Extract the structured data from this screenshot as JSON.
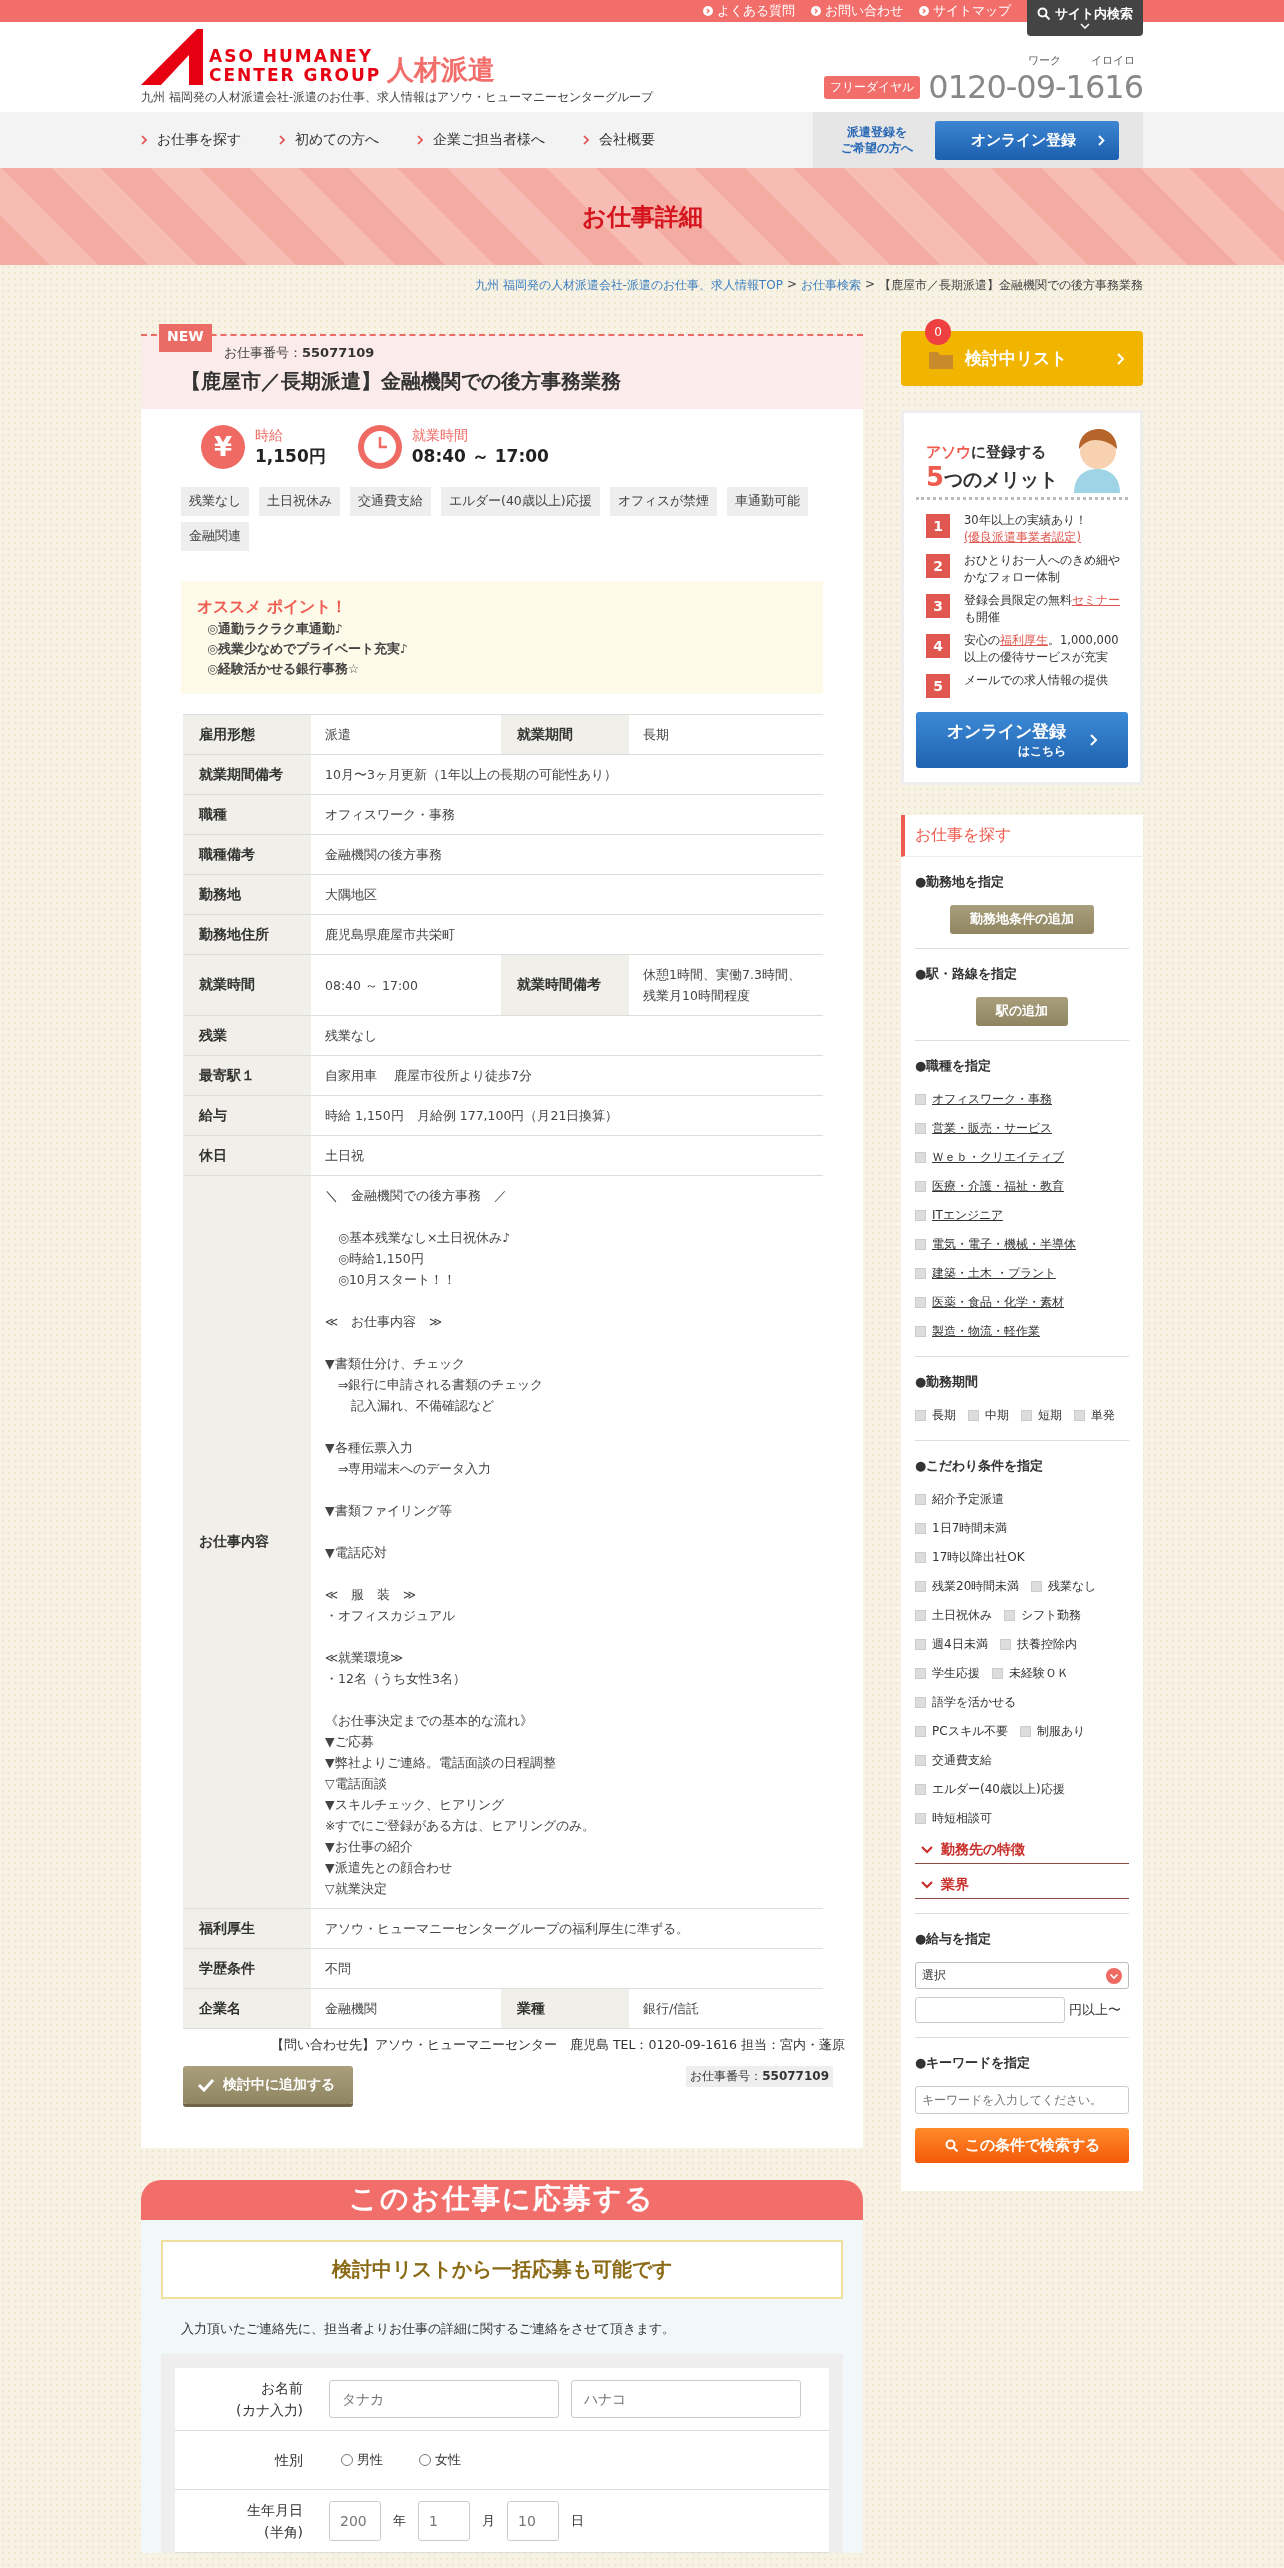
{
  "top_links": [
    "よくある質問",
    "お問い合わせ",
    "サイトマップ"
  ],
  "site_search": "サイト内検索",
  "header": {
    "logo_line1": "ASO HUMANEY",
    "logo_line2": "CENTER GROUP",
    "logo_suffix": "人材派遣",
    "tagline": "九州 福岡発の人材派遣会社-派遣のお仕事、求人情報はアソウ・ヒューマニーセンターグループ",
    "phone_badge": "フリーダイヤル",
    "phone_reading_1": "ワーク",
    "phone_reading_2": "イロイロ",
    "phone": "0120-09-1616"
  },
  "nav": {
    "items": [
      "お仕事を探す",
      "初めての方へ",
      "企業ご担当者様へ",
      "会社概要"
    ],
    "register_note": [
      "派遣登録を",
      "ご希望の方へ"
    ],
    "register_button": "オンライン登録"
  },
  "banner_title": "お仕事詳細",
  "breadcrumb": {
    "separator": ">",
    "links": [
      "九州 福岡発の人材派遣会社-派遣のお仕事、求人情報TOP",
      "お仕事検索"
    ],
    "current": "【鹿屋市／長期派遣】金融機関での後方事務業務"
  },
  "job": {
    "badge": "NEW",
    "number": "お仕事番号：**55077109**",
    "title": "【鹿屋市／長期派遣】金融機関での後方事務業務",
    "wage_symbol": "¥",
    "wage_label": "時給",
    "wage": "1,150円",
    "hours_label": "就業時間",
    "hours": "08:40 ～ 17:00",
    "tags": [
      "残業なし",
      "土日祝休み",
      "交通費支給",
      "エルダー(40歳以上)応援",
      "オフィスが禁煙",
      "車通勤可能",
      "金融関連"
    ],
    "points_title": "オススメ ポイント！",
    "points": [
      "◎通勤ラクラク車通勤♪",
      "◎残業少なめでプライベート充実♪",
      "◎経験活かせる銀行事務☆"
    ],
    "table": [
      {
        "cells": [
          {
            "label": "雇用形態",
            "value": "派遣"
          },
          {
            "label": "就業期間",
            "value": "長期"
          }
        ]
      },
      {
        "cells": [
          {
            "label": "就業期間備考",
            "value": "10月〜3ヶ月更新（1年以上の長期の可能性あり）"
          }
        ]
      },
      {
        "cells": [
          {
            "label": "職種",
            "value": "オフィスワーク・事務"
          }
        ]
      },
      {
        "cells": [
          {
            "label": "職種備考",
            "value": "金融機関の後方事務"
          }
        ]
      },
      {
        "cells": [
          {
            "label": "勤務地",
            "value": "大隅地区"
          }
        ]
      },
      {
        "cells": [
          {
            "label": "勤務地住所",
            "value": "鹿児島県鹿屋市共栄町"
          }
        ]
      },
      {
        "cells": [
          {
            "label": "就業時間",
            "value": "08:40 ～ 17:00"
          },
          {
            "label": "就業時間備考",
            "blocks": [
              [
                "休憩1時間、実働7.3時間、",
                "残業月10時間程度"
              ]
            ]
          }
        ]
      },
      {
        "cells": [
          {
            "label": "残業",
            "value": "残業なし"
          }
        ]
      },
      {
        "cells": [
          {
            "label": "最寄駅１",
            "value": "自家用車　 鹿屋市役所より徒歩7分"
          }
        ]
      },
      {
        "cells": [
          {
            "label": "給与",
            "value": "時給 1,150円　月給例 177,100円（月21日換算）"
          }
        ]
      },
      {
        "cells": [
          {
            "label": "休日",
            "value": "土日祝"
          }
        ]
      },
      {
        "cells": [
          {
            "label": "お仕事内容",
            "blocks": [
              [
                "＼　金融機関での後方事務　／"
              ],
              [
                "　◎基本残業なし×土日祝休み♪",
                "　◎時給1,150円",
                "　◎10月スタート！！"
              ],
              [
                "≪　お仕事内容　≫"
              ],
              [
                "▼書類仕分け、チェック",
                "　⇒銀行に申請される書類のチェック",
                "　　記入漏れ、不備確認など"
              ],
              [
                "▼各種伝票入力",
                "　⇒専用端末へのデータ入力"
              ],
              [
                "▼書類ファイリング等"
              ],
              [
                "▼電話応対"
              ],
              [
                "≪　服　装　≫",
                "・オフィスカジュアル"
              ],
              [
                "≪就業環境≫",
                "・12名（うち女性3名）"
              ],
              [
                "《お仕事決定までの基本的な流れ》",
                "▼ご応募",
                "▼弊社よりご連絡。電話面談の日程調整",
                "▽電話面談",
                "▼スキルチェック、ヒアリング",
                "※すでにご登録がある方は、ヒアリングのみ。",
                "▼お仕事の紹介",
                "▼派遣先との顔合わせ",
                "▽就業決定"
              ]
            ]
          }
        ]
      },
      {
        "cells": [
          {
            "label": "福利厚生",
            "value": "アソウ・ヒューマニーセンターグループの福利厚生に準ずる。"
          }
        ]
      },
      {
        "cells": [
          {
            "label": "学歴条件",
            "value": "不問"
          }
        ]
      },
      {
        "cells": [
          {
            "label": "企業名",
            "value": "金融機関"
          },
          {
            "label": "業種",
            "value": "銀行/信託"
          }
        ]
      }
    ],
    "contact": "【問い合わせ先】アソウ・ヒューマニーセンター　鹿児島 TEL：0120-09-1616 担当：宮内・蓬原",
    "add_button": "検討中に追加する",
    "number_footer": "お仕事番号：**55077109**"
  },
  "apply": {
    "title": "このお仕事に応募する",
    "bulk_note": "検討中リストから一括応募も可能です",
    "intro": "入力頂いたご連絡先に、担当者よりお仕事の詳細に関するご連絡をさせて頂きます。",
    "rows": [
      {
        "kind": "name",
        "label": "お名前\n(カナ入力)",
        "placeholders": [
          "タナカ",
          "ハナコ"
        ]
      },
      {
        "kind": "radio",
        "label": "性別",
        "options": [
          {
            "label": "男性",
            "selected": false
          },
          {
            "label": "女性",
            "selected": false
          }
        ]
      },
      {
        "kind": "date",
        "label": "生年月日\n(半角)",
        "fields": [
          {
            "placeholder": "200",
            "unit": "年"
          },
          {
            "placeholder": "1",
            "unit": "月"
          },
          {
            "placeholder": "10",
            "unit": "日"
          }
        ]
      }
    ]
  },
  "sidebar": {
    "list_button": "検討中リスト",
    "list_count": "0",
    "merit": {
      "heading": [
        [
          {
            "text": "アソウ",
            "accent": true
          },
          {
            "text": "に登録する",
            "accent": false
          }
        ],
        [
          {
            "text": "5",
            "accent": true
          },
          {
            "text": "つのメリット",
            "accent": false
          }
        ]
      ],
      "items": [
        {
          "number": "1",
          "parts": [
            {
              "text": "30年以上の実績あり！",
              "link": false
            },
            {
              "text": "(優良派遣事業者認定)",
              "link": true
            }
          ]
        },
        {
          "number": "2",
          "parts": [
            {
              "text": "おひとりお一人へのきめ細やかなフォロー体制",
              "link": false
            }
          ]
        },
        {
          "number": "3",
          "parts": [
            {
              "text": "登録会員限定の無料",
              "link": false
            },
            {
              "text": "セミナー",
              "link": true
            },
            {
              "text": "も開催",
              "link": false
            }
          ]
        },
        {
          "number": "4",
          "parts": [
            {
              "text": "安心の",
              "link": false
            },
            {
              "text": "福利厚生",
              "link": true
            },
            {
              "text": "。1,000,000以上の優待サービスが充実",
              "link": false
            }
          ]
        },
        {
          "number": "5",
          "parts": [
            {
              "text": "メールでの求人情報の提供",
              "link": false
            }
          ]
        }
      ],
      "button_main": "オンライン登録",
      "button_sub": "はこちら"
    },
    "search": {
      "title": "お仕事を探す",
      "sections": [
        {
          "kind": "button",
          "heading": "●勤務地を指定",
          "button": "勤務地条件の追加"
        },
        {
          "kind": "button",
          "heading": "●駅・路線を指定",
          "button": "駅の追加"
        },
        {
          "kind": "links",
          "heading": "●職種を指定",
          "items": [
            {
              "label": "オフィスワーク・事務",
              "checked": false
            },
            {
              "label": "営業・販売・サービス",
              "checked": false
            },
            {
              "label": "Ｗｅｂ・クリエイティブ",
              "checked": false
            },
            {
              "label": "医療・介護・福祉・教育",
              "checked": false
            },
            {
              "label": "ITエンジニア",
              "checked": false
            },
            {
              "label": "電気・電子・機械・半導体",
              "checked": false
            },
            {
              "label": "建築・土木 ・プラント",
              "checked": false
            },
            {
              "label": "医薬・食品・化学・素材",
              "checked": false
            },
            {
              "label": "製造・物流・軽作業",
              "checked": false
            }
          ]
        },
        {
          "kind": "rows",
          "heading": "●勤務期間",
          "rows": [
            [
              {
                "label": "長期",
                "checked": false
              },
              {
                "label": "中期",
                "checked": false
              },
              {
                "label": "短期",
                "checked": false
              },
              {
                "label": "単発",
                "checked": false
              }
            ]
          ]
        },
        {
          "kind": "rows",
          "heading": "●こだわり条件を指定",
          "rows": [
            [
              {
                "label": "紹介予定派遣",
                "checked": false
              }
            ],
            [
              {
                "label": "1日7時間未満",
                "checked": false
              }
            ],
            [
              {
                "label": "17時以降出社OK",
                "checked": false
              }
            ],
            [
              {
                "label": "残業20時間未満",
                "checked": false
              },
              {
                "label": "残業なし",
                "checked": false
              }
            ],
            [
              {
                "label": "土日祝休み",
                "checked": false
              },
              {
                "label": "シフト勤務",
                "checked": false
              }
            ],
            [
              {
                "label": "週4日未満",
                "checked": false
              },
              {
                "label": "扶養控除内",
                "checked": false
              }
            ],
            [
              {
                "label": "学生応援",
                "checked": false
              },
              {
                "label": "未経験ＯＫ",
                "checked": false
              }
            ],
            [
              {
                "label": "語学を活かせる",
                "checked": false
              }
            ],
            [
              {
                "label": "PCスキル不要",
                "checked": false
              },
              {
                "label": "制服あり",
                "checked": false
              }
            ],
            [
              {
                "label": "交通費支給",
                "checked": false
              }
            ],
            [
              {
                "label": "エルダー(40歳以上)応援",
                "checked": false
              }
            ],
            [
              {
                "label": "時短相談可",
                "checked": false
              }
            ]
          ],
          "folds": [
            {
              "label": "勤務先の特徴",
              "expanded": false
            },
            {
              "label": "業界",
              "expanded": false
            }
          ]
        },
        {
          "kind": "salary",
          "heading": "●給与を指定",
          "select": "選択",
          "unit": "円以上〜"
        },
        {
          "kind": "keyword",
          "heading": "●キーワードを指定",
          "placeholder": "キーワードを入力してください。",
          "button": "この条件で検索する"
        }
      ]
    }
  }
}
